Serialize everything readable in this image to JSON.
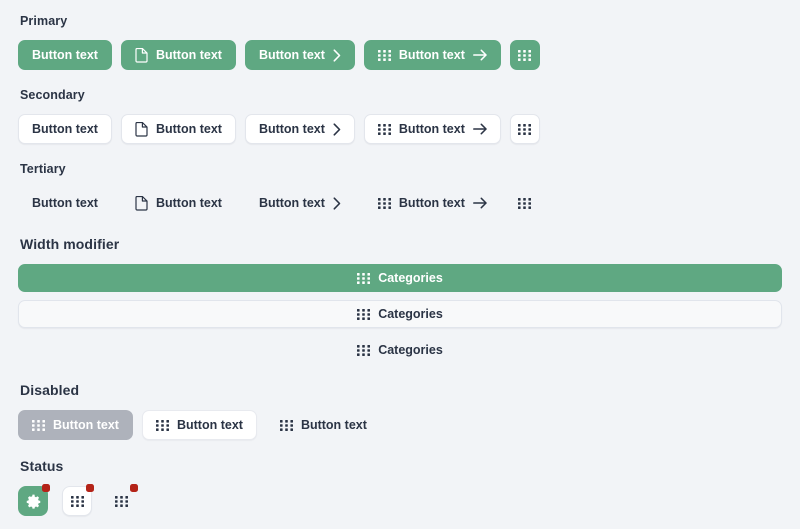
{
  "theme": {
    "page_background": "#F2F4F7",
    "primary_green": "#5FA882",
    "text_dark": "#2B3445",
    "disabled_gray": "#AEB2BB",
    "badge_red": "#B42318",
    "border_light": "#E3E6EC"
  },
  "sections": {
    "primary": {
      "title": "Primary",
      "buttons": [
        {
          "label": "Button text",
          "leading_icon": "",
          "trailing_icon": ""
        },
        {
          "label": "Button text",
          "leading_icon": "file-icon",
          "trailing_icon": ""
        },
        {
          "label": "Button text",
          "leading_icon": "",
          "trailing_icon": "chevron-right-icon"
        },
        {
          "label": "Button text",
          "leading_icon": "grid-dots-icon",
          "trailing_icon": "arrow-right-icon"
        },
        {
          "label": "",
          "leading_icon": "grid-dots-icon",
          "trailing_icon": ""
        }
      ]
    },
    "secondary": {
      "title": "Secondary",
      "buttons": [
        {
          "label": "Button text",
          "leading_icon": "",
          "trailing_icon": ""
        },
        {
          "label": "Button text",
          "leading_icon": "file-icon",
          "trailing_icon": ""
        },
        {
          "label": "Button text",
          "leading_icon": "",
          "trailing_icon": "chevron-right-icon"
        },
        {
          "label": "Button text",
          "leading_icon": "grid-dots-icon",
          "trailing_icon": "arrow-right-icon"
        },
        {
          "label": "",
          "leading_icon": "grid-dots-icon",
          "trailing_icon": ""
        }
      ]
    },
    "tertiary": {
      "title": "Tertiary",
      "buttons": [
        {
          "label": "Button text",
          "leading_icon": "",
          "trailing_icon": ""
        },
        {
          "label": "Button text",
          "leading_icon": "file-icon",
          "trailing_icon": ""
        },
        {
          "label": "Button text",
          "leading_icon": "",
          "trailing_icon": "chevron-right-icon"
        },
        {
          "label": "Button text",
          "leading_icon": "grid-dots-icon",
          "trailing_icon": "arrow-right-icon"
        },
        {
          "label": "",
          "leading_icon": "grid-dots-icon",
          "trailing_icon": ""
        }
      ]
    },
    "width_modifier": {
      "title": "Width modifier",
      "buttons": [
        {
          "label": "Categories",
          "leading_icon": "grid-dots-icon",
          "variant": "primary"
        },
        {
          "label": "Categories",
          "leading_icon": "grid-dots-icon",
          "variant": "secondary"
        },
        {
          "label": "Categories",
          "leading_icon": "grid-dots-icon",
          "variant": "tertiary"
        }
      ]
    },
    "disabled": {
      "title": "Disabled",
      "buttons": [
        {
          "label": "Button text",
          "leading_icon": "grid-dots-icon",
          "variant": "primary"
        },
        {
          "label": "Button text",
          "leading_icon": "grid-dots-icon",
          "variant": "secondary"
        },
        {
          "label": "Button text",
          "leading_icon": "grid-dots-icon",
          "variant": "tertiary"
        }
      ]
    },
    "status": {
      "title": "Status",
      "buttons": [
        {
          "icon": "gear-icon",
          "variant": "primary",
          "badge": true
        },
        {
          "icon": "grid-dots-icon",
          "variant": "secondary",
          "badge": true
        },
        {
          "icon": "grid-dots-icon",
          "variant": "tertiary",
          "badge": true
        }
      ]
    }
  }
}
